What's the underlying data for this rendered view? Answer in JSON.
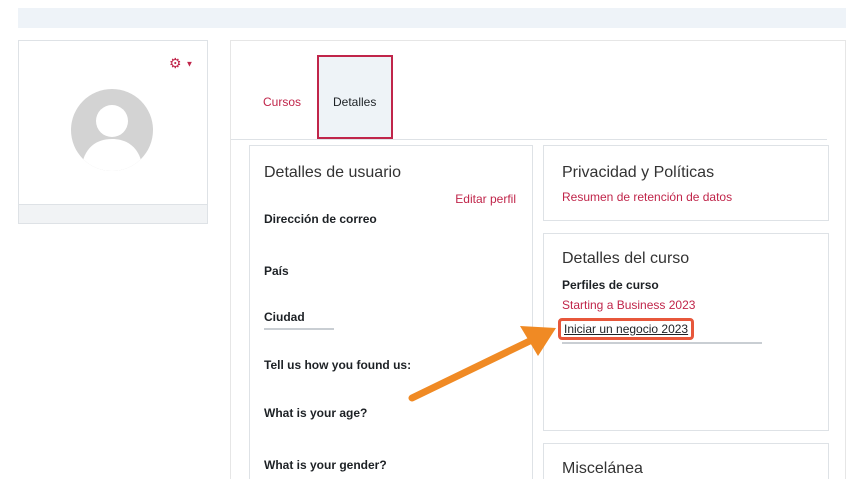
{
  "colors": {
    "accent": "#c0254a",
    "annotation_arrow": "#f08a24",
    "highlight_box": "#e7573b"
  },
  "profile": {
    "gear_icon": "gear-icon",
    "caret_icon": "caret-down-icon"
  },
  "tabs": [
    {
      "label": "Cursos"
    },
    {
      "label": "Detalles"
    }
  ],
  "user_details": {
    "title": "Detalles de usuario",
    "edit_link": "Editar perfil",
    "fields": [
      "Dirección de correo",
      "País",
      "Ciudad",
      "Tell us how you found us:",
      "What is your age?",
      "What is your gender?"
    ]
  },
  "privacy": {
    "title": "Privacidad y Políticas",
    "link": "Resumen de retención de datos"
  },
  "course_details": {
    "title": "Detalles del curso",
    "subtitle": "Perfiles de curso",
    "courses": [
      "Starting a Business 2023",
      "Iniciar un negocio 2023"
    ]
  },
  "misc": {
    "title": "Miscelánea"
  }
}
